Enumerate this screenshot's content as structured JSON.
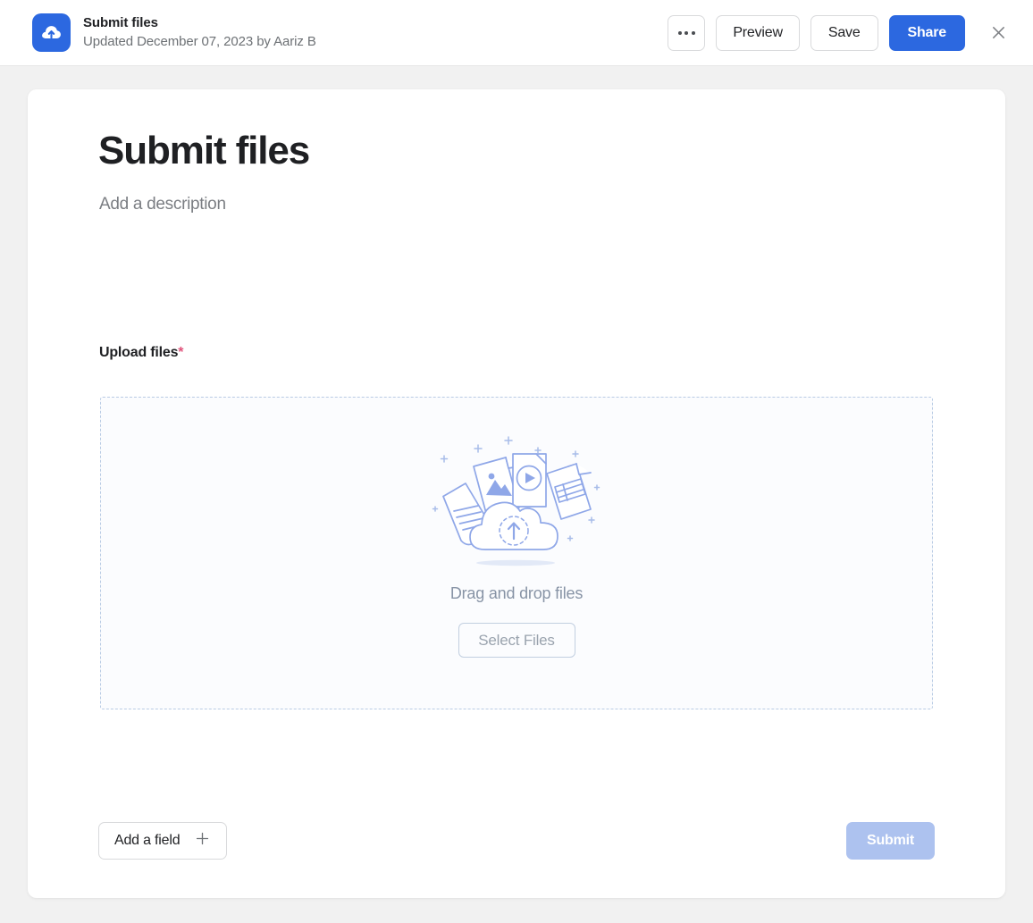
{
  "header": {
    "app_icon": "cloud-upload-icon",
    "title": "Submit files",
    "subtitle": "Updated December 07, 2023 by Aariz B",
    "more_label": "",
    "preview_label": "Preview",
    "save_label": "Save",
    "share_label": "Share",
    "close_label": "close-icon",
    "brand_color": "#2c68e0"
  },
  "form": {
    "title": "Submit files",
    "description_placeholder": "Add a description",
    "field": {
      "label": "Upload files",
      "required_marker": "*",
      "required_color": "#e0527a"
    },
    "dropzone": {
      "illustration": "files-cloud-upload-illustration",
      "hint": "Drag and drop files",
      "select_label": "Select Files",
      "border_color": "#b9cbe4",
      "background": "#fbfcfe"
    }
  },
  "footer": {
    "add_field_label": "Add a field",
    "add_field_icon": "plus-icon",
    "submit_label": "Submit",
    "submit_disabled_color": "#adc2ef"
  }
}
